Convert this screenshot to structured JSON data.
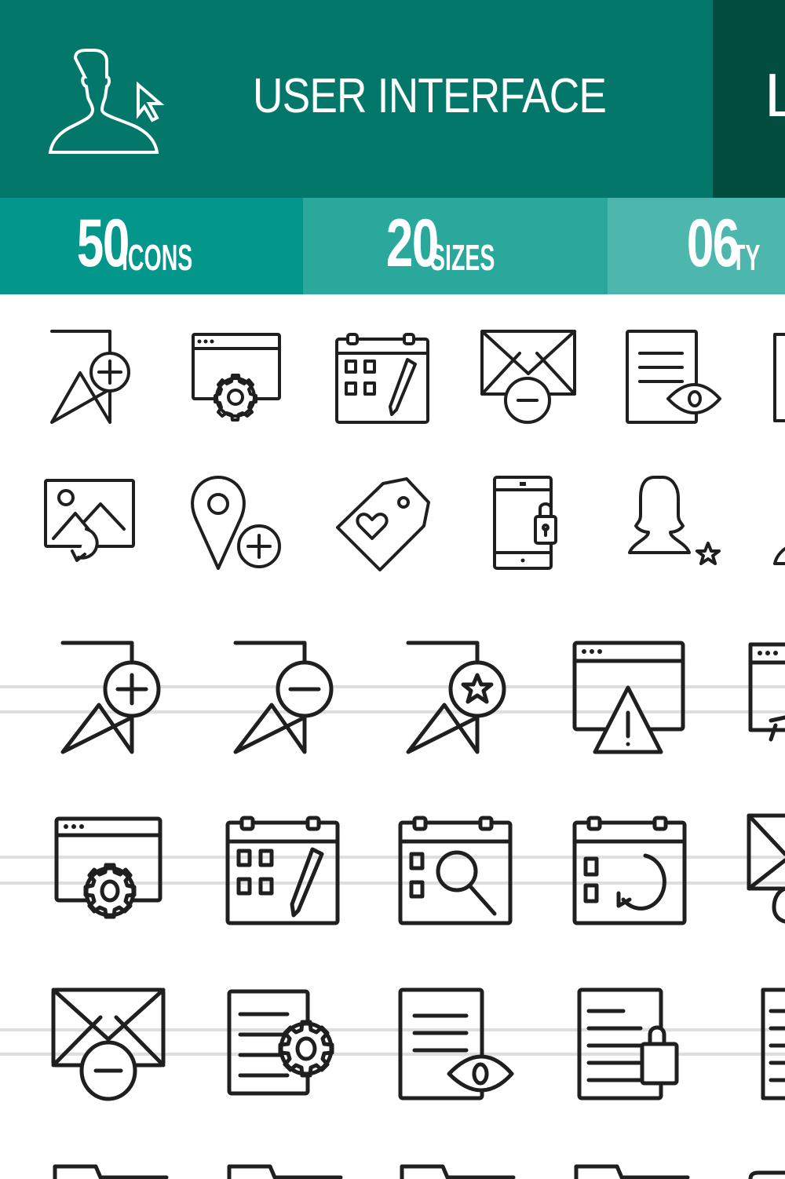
{
  "header": {
    "title": "USER INTERFACE",
    "edge_letter": "L",
    "icon": "user-cursor-icon",
    "colors": {
      "primary": "#03786a",
      "dark": "#034d40"
    }
  },
  "stats": [
    {
      "number": "50",
      "label": "ICONS",
      "color": "#03968a"
    },
    {
      "number": "20",
      "label": "SIZES",
      "color": "#2aa89b"
    },
    {
      "number": "06",
      "label": "TY",
      "color": "#4eb7ad"
    }
  ],
  "icon_rows": [
    [
      "bookmark-add-icon",
      "browser-settings-icon",
      "calendar-edit-icon",
      "mail-remove-icon",
      "document-view-icon",
      "partial-icon"
    ],
    [
      "image-refresh-icon",
      "location-add-icon",
      "tag-heart-icon",
      "mobile-lock-icon",
      "female-user-star-icon",
      "partial-icon"
    ],
    [
      "bookmark-add-icon",
      "bookmark-remove-icon",
      "bookmark-star-icon",
      "browser-warning-icon",
      "browser-cursor-icon"
    ],
    [
      "browser-settings-icon",
      "calendar-edit-icon",
      "calendar-search-icon",
      "calendar-refresh-icon",
      "mail-partial-icon"
    ],
    [
      "mail-remove-icon",
      "document-settings-icon",
      "document-view-icon",
      "document-lock-icon",
      "document-partial-icon"
    ],
    [
      "folder-icon",
      "folder-icon",
      "folder-icon",
      "folder-icon",
      "folder-icon"
    ]
  ]
}
